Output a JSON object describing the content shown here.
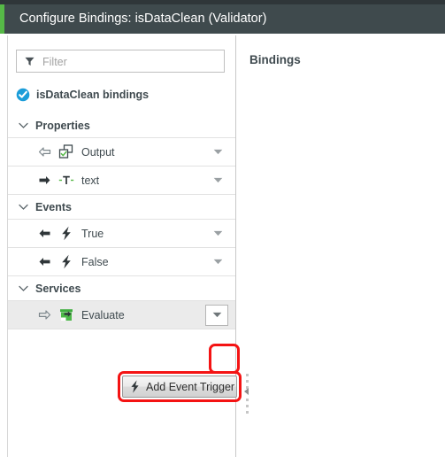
{
  "window": {
    "title": "Configure Bindings: isDataClean (Validator)",
    "accent_color": "#56b947",
    "titlebar_color": "#3f4a4d"
  },
  "left_panel": {
    "filter": {
      "placeholder": "Filter",
      "value": "",
      "icon": "filter-funnel-icon"
    },
    "root_node": {
      "label": "isDataClean bindings",
      "icon": "blue-check-circle-icon",
      "icon_color": "#1b9dd9"
    },
    "sections": [
      {
        "label": "Properties",
        "caret": "chevron-down-icon",
        "rows": [
          {
            "label": "Output",
            "direction_icon": "arrow-left-outline-icon",
            "type_icon": "output-squares-check-icon",
            "dropdown": "caret-down-icon",
            "highlighted": false,
            "dropdown_boxed": false
          },
          {
            "label": "text",
            "direction_icon": "arrow-right-solid-icon",
            "type_icon": "text-type-icon",
            "dropdown": "caret-down-icon",
            "highlighted": false,
            "dropdown_boxed": false
          }
        ]
      },
      {
        "label": "Events",
        "caret": "chevron-down-icon",
        "rows": [
          {
            "label": "True",
            "direction_icon": "arrow-left-solid-icon",
            "type_icon": "lightning-bolt-icon",
            "dropdown": "caret-down-icon",
            "highlighted": false,
            "dropdown_boxed": false
          },
          {
            "label": "False",
            "direction_icon": "arrow-left-solid-icon",
            "type_icon": "lightning-bolt-icon",
            "dropdown": "caret-down-icon",
            "highlighted": false,
            "dropdown_boxed": false
          }
        ]
      },
      {
        "label": "Services",
        "caret": "chevron-down-icon",
        "rows": [
          {
            "label": "Evaluate",
            "direction_icon": "arrow-right-outline-icon",
            "type_icon": "service-green-icon",
            "dropdown": "caret-down-icon",
            "highlighted": true,
            "dropdown_boxed": true
          }
        ]
      }
    ],
    "context_menu": {
      "items": [
        {
          "label": "Add Event Trigger",
          "icon": "lightning-bolt-icon"
        }
      ]
    },
    "annotations": {
      "color": "#f41313",
      "targets": [
        "evaluate-dropdown-button",
        "add-event-trigger-menu-item"
      ]
    }
  },
  "right_panel": {
    "title": "Bindings"
  }
}
